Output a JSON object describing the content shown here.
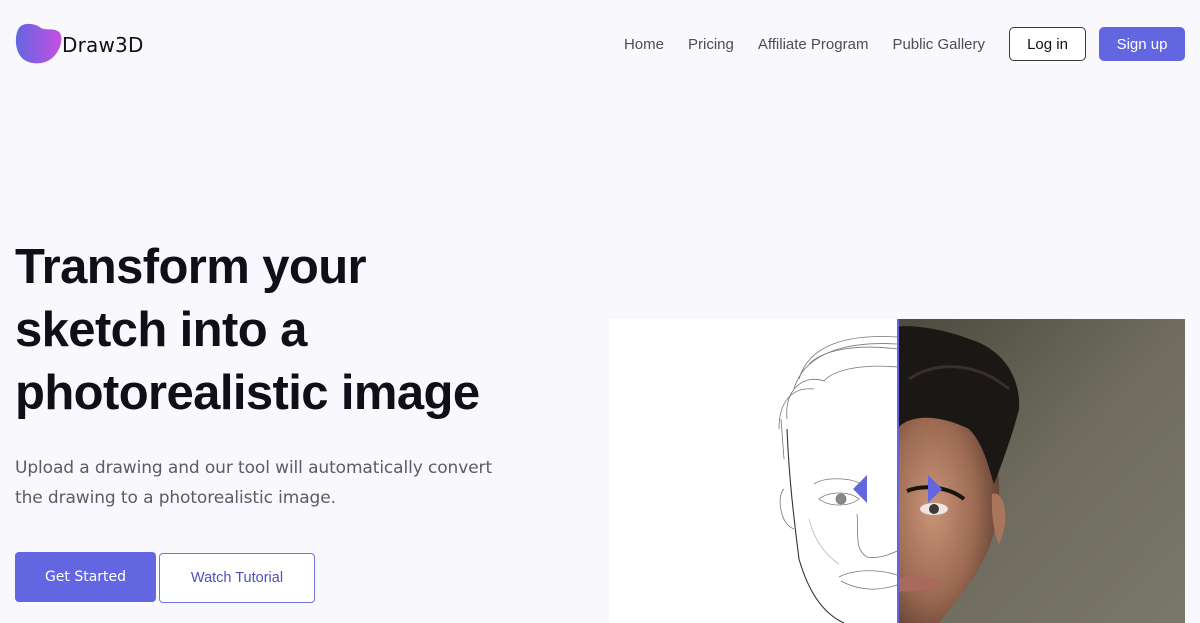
{
  "brand": {
    "name": "Draw3D",
    "logo_icon": "blob-logo-icon",
    "gradient_start": "#6366e1",
    "gradient_end": "#c64fe0"
  },
  "nav": {
    "links": [
      {
        "label": "Home"
      },
      {
        "label": "Pricing"
      },
      {
        "label": "Affiliate Program"
      },
      {
        "label": "Public Gallery"
      }
    ],
    "login_label": "Log in",
    "signup_label": "Sign up"
  },
  "hero": {
    "title_lines": [
      "Transform your",
      "sketch into a",
      "photorealistic image"
    ],
    "subtitle_lines": [
      "Upload a drawing and our tool will automatically convert",
      "the drawing to a photorealistic image."
    ],
    "primary_cta": "Get Started",
    "secondary_cta": "Watch Tutorial"
  },
  "compare": {
    "before_label": "sketch",
    "after_label": "photo",
    "slider_position": 0.5,
    "handle_icons": [
      "arrow-left-icon",
      "arrow-right-icon"
    ],
    "accent": "#6366e1"
  }
}
